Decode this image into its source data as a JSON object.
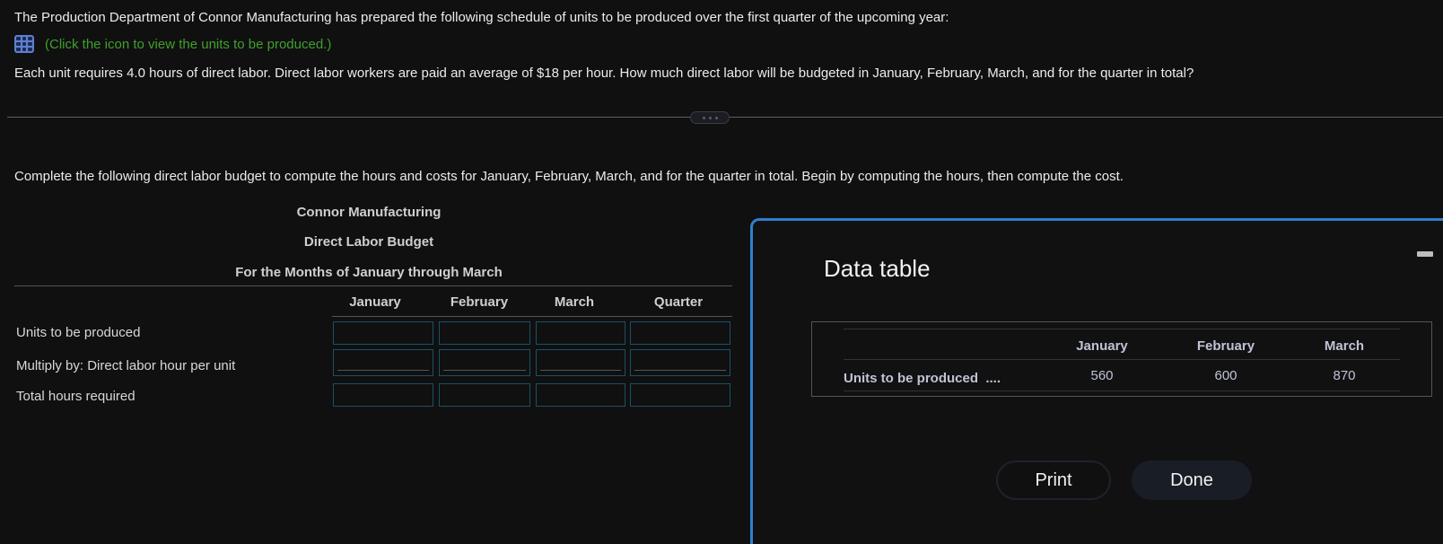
{
  "question": {
    "intro": "The Production Department of Connor Manufacturing has prepared the following schedule of units to be produced over the first quarter of the upcoming year:",
    "link_text": "(Click the icon to view the units to be produced.)",
    "link_icon": "table-grid-icon",
    "body": "Each unit requires 4.0 hours of direct labor. Direct labor workers are paid an average of $18 per hour. How much direct labor will be budgeted in January, February, March, and for the quarter in total?"
  },
  "instructions": "Complete the following direct labor budget to compute the hours and costs for January, February, March, and for the quarter in total. Begin by computing the hours, then compute the cost.",
  "budget": {
    "company": "Connor Manufacturing",
    "title": "Direct Labor Budget",
    "period": "For the Months of January through March",
    "columns": [
      "January",
      "February",
      "March",
      "Quarter"
    ],
    "rows": [
      {
        "label": "Units to be produced",
        "values": [
          "",
          "",
          "",
          ""
        ]
      },
      {
        "label": "Multiply by: Direct labor hour per unit",
        "values": [
          "",
          "",
          "",
          ""
        ]
      },
      {
        "label": "Total hours required",
        "values": [
          "",
          "",
          "",
          ""
        ]
      }
    ]
  },
  "modal": {
    "title": "Data table",
    "table": {
      "columns": [
        "January",
        "February",
        "March"
      ],
      "row_label": "Units to be produced",
      "leader": "....",
      "values": [
        "560",
        "600",
        "870"
      ]
    },
    "print_label": "Print",
    "done_label": "Done"
  },
  "colors": {
    "link_green": "#3fa02a",
    "modal_border": "#2f7fd0",
    "input_border": "#1d5066"
  }
}
